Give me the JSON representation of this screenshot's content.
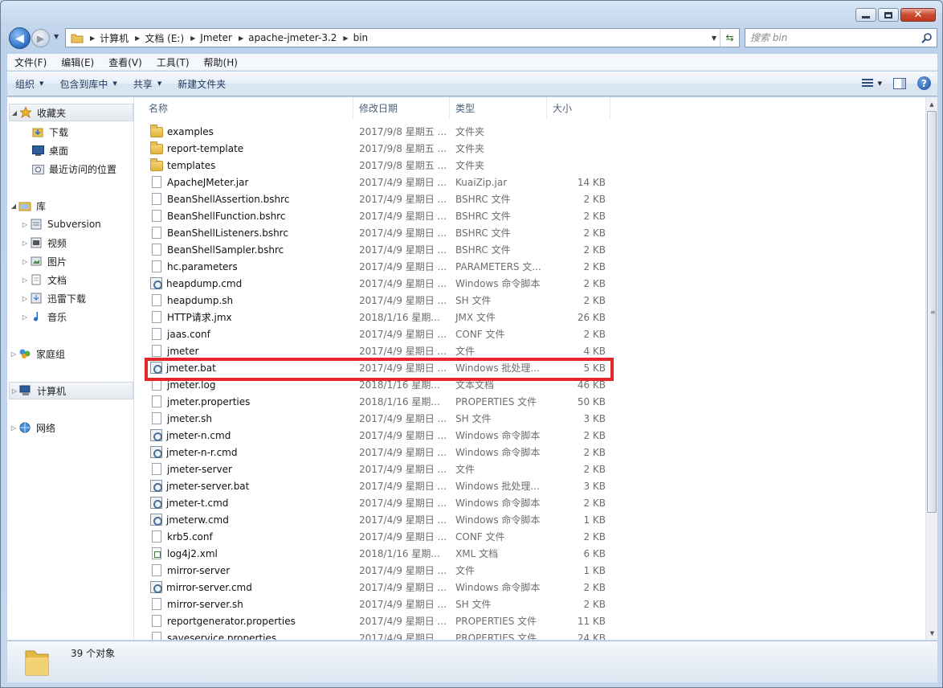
{
  "window": {
    "min_label": "minimize",
    "max_label": "maximize",
    "close_symbol": "✕"
  },
  "address": {
    "breadcrumbs": [
      "计算机",
      "文档 (E:)",
      "Jmeter",
      "apache-jmeter-3.2",
      "bin"
    ]
  },
  "search": {
    "placeholder": "搜索 bin"
  },
  "menu": [
    "文件(F)",
    "编辑(E)",
    "查看(V)",
    "工具(T)",
    "帮助(H)"
  ],
  "toolbar": {
    "organize": "组织",
    "include_library": "包含到库中",
    "share": "共享",
    "new_folder": "新建文件夹"
  },
  "sidebar": {
    "favorites": "收藏夹",
    "downloads": "下载",
    "desktop": "桌面",
    "recent": "最近访问的位置",
    "libraries": "库",
    "subversion": "Subversion",
    "videos": "视频",
    "pictures": "图片",
    "documents": "文档",
    "thunder": "迅雷下载",
    "music": "音乐",
    "homegroup": "家庭组",
    "computer": "计算机",
    "network": "网络"
  },
  "columns": {
    "name": "名称",
    "date": "修改日期",
    "type": "类型",
    "size": "大小"
  },
  "files": [
    {
      "name": "examples",
      "date": "2017/9/8 星期五 ...",
      "type": "文件夹",
      "size": "",
      "icon": "folder"
    },
    {
      "name": "report-template",
      "date": "2017/9/8 星期五 ...",
      "type": "文件夹",
      "size": "",
      "icon": "folder"
    },
    {
      "name": "templates",
      "date": "2017/9/8 星期五 ...",
      "type": "文件夹",
      "size": "",
      "icon": "folder"
    },
    {
      "name": "ApacheJMeter.jar",
      "date": "2017/4/9 星期日 ...",
      "type": "KuaiZip.jar",
      "size": "14 KB",
      "icon": "doc"
    },
    {
      "name": "BeanShellAssertion.bshrc",
      "date": "2017/4/9 星期日 ...",
      "type": "BSHRC 文件",
      "size": "2 KB",
      "icon": "doc"
    },
    {
      "name": "BeanShellFunction.bshrc",
      "date": "2017/4/9 星期日 ...",
      "type": "BSHRC 文件",
      "size": "2 KB",
      "icon": "doc"
    },
    {
      "name": "BeanShellListeners.bshrc",
      "date": "2017/4/9 星期日 ...",
      "type": "BSHRC 文件",
      "size": "2 KB",
      "icon": "doc"
    },
    {
      "name": "BeanShellSampler.bshrc",
      "date": "2017/4/9 星期日 ...",
      "type": "BSHRC 文件",
      "size": "2 KB",
      "icon": "doc"
    },
    {
      "name": "hc.parameters",
      "date": "2017/4/9 星期日 ...",
      "type": "PARAMETERS 文...",
      "size": "2 KB",
      "icon": "doc"
    },
    {
      "name": "heapdump.cmd",
      "date": "2017/4/9 星期日 ...",
      "type": "Windows 命令脚本",
      "size": "2 KB",
      "icon": "cmd"
    },
    {
      "name": "heapdump.sh",
      "date": "2017/4/9 星期日 ...",
      "type": "SH 文件",
      "size": "2 KB",
      "icon": "doc"
    },
    {
      "name": "HTTP请求.jmx",
      "date": "2018/1/16 星期...",
      "type": "JMX 文件",
      "size": "26 KB",
      "icon": "doc"
    },
    {
      "name": "jaas.conf",
      "date": "2017/4/9 星期日 ...",
      "type": "CONF 文件",
      "size": "2 KB",
      "icon": "doc"
    },
    {
      "name": "jmeter",
      "date": "2017/4/9 星期日 ...",
      "type": "文件",
      "size": "4 KB",
      "icon": "doc"
    },
    {
      "name": "jmeter.bat",
      "date": "2017/4/9 星期日 ...",
      "type": "Windows 批处理...",
      "size": "5 KB",
      "icon": "cmd"
    },
    {
      "name": "jmeter.log",
      "date": "2018/1/16 星期...",
      "type": "文本文档",
      "size": "46 KB",
      "icon": "doc"
    },
    {
      "name": "jmeter.properties",
      "date": "2018/1/16 星期...",
      "type": "PROPERTIES 文件",
      "size": "50 KB",
      "icon": "doc"
    },
    {
      "name": "jmeter.sh",
      "date": "2017/4/9 星期日 ...",
      "type": "SH 文件",
      "size": "3 KB",
      "icon": "doc"
    },
    {
      "name": "jmeter-n.cmd",
      "date": "2017/4/9 星期日 ...",
      "type": "Windows 命令脚本",
      "size": "2 KB",
      "icon": "cmd"
    },
    {
      "name": "jmeter-n-r.cmd",
      "date": "2017/4/9 星期日 ...",
      "type": "Windows 命令脚本",
      "size": "2 KB",
      "icon": "cmd"
    },
    {
      "name": "jmeter-server",
      "date": "2017/4/9 星期日 ...",
      "type": "文件",
      "size": "2 KB",
      "icon": "doc"
    },
    {
      "name": "jmeter-server.bat",
      "date": "2017/4/9 星期日 ...",
      "type": "Windows 批处理...",
      "size": "3 KB",
      "icon": "cmd"
    },
    {
      "name": "jmeter-t.cmd",
      "date": "2017/4/9 星期日 ...",
      "type": "Windows 命令脚本",
      "size": "2 KB",
      "icon": "cmd"
    },
    {
      "name": "jmeterw.cmd",
      "date": "2017/4/9 星期日 ...",
      "type": "Windows 命令脚本",
      "size": "1 KB",
      "icon": "cmd"
    },
    {
      "name": "krb5.conf",
      "date": "2017/4/9 星期日 ...",
      "type": "CONF 文件",
      "size": "2 KB",
      "icon": "doc"
    },
    {
      "name": "log4j2.xml",
      "date": "2018/1/16 星期...",
      "type": "XML 文档",
      "size": "6 KB",
      "icon": "xml"
    },
    {
      "name": "mirror-server",
      "date": "2017/4/9 星期日 ...",
      "type": "文件",
      "size": "1 KB",
      "icon": "doc"
    },
    {
      "name": "mirror-server.cmd",
      "date": "2017/4/9 星期日 ...",
      "type": "Windows 命令脚本",
      "size": "2 KB",
      "icon": "cmd"
    },
    {
      "name": "mirror-server.sh",
      "date": "2017/4/9 星期日 ...",
      "type": "SH 文件",
      "size": "2 KB",
      "icon": "doc"
    },
    {
      "name": "reportgenerator.properties",
      "date": "2017/4/9 星期日 ...",
      "type": "PROPERTIES 文件",
      "size": "11 KB",
      "icon": "doc"
    },
    {
      "name": "saveservice.properties",
      "date": "2017/4/9 星期日 ...",
      "type": "PROPERTIES 文件",
      "size": "24 KB",
      "icon": "doc"
    }
  ],
  "status": {
    "count": "39 个对象"
  },
  "colors": {
    "highlight": "#e5262a",
    "accent": "#2b6cc4"
  }
}
